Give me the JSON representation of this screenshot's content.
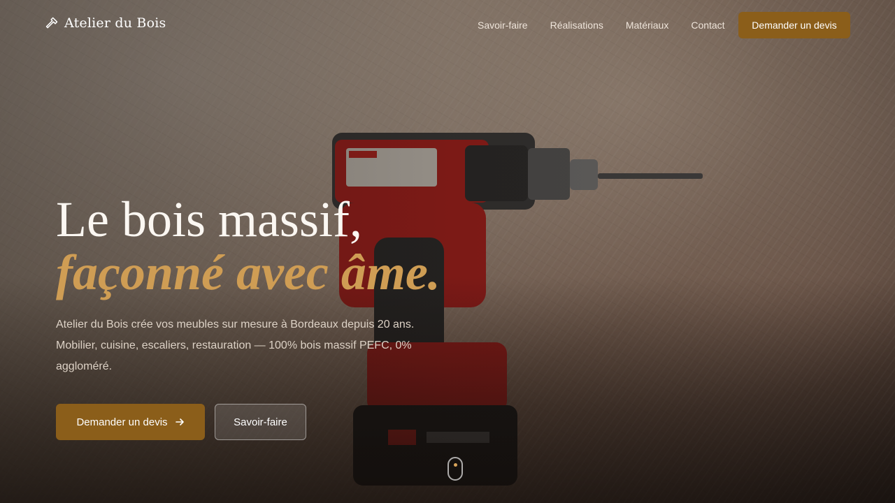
{
  "brand": {
    "name": "Atelier du Bois",
    "icon": "hammer-icon"
  },
  "nav": {
    "items": [
      "Savoir-faire",
      "Réalisations",
      "Matériaux",
      "Contact"
    ],
    "cta": "Demander un devis"
  },
  "hero": {
    "title_line1": "Le bois massif,",
    "title_line2": "façonné avec âme.",
    "description": "Atelier du Bois crée vos meubles sur mesure à Bordeaux depuis 20 ans. Mobilier, cuisine, escaliers, restauration — 100% bois massif PEFC, 0% aggloméré.",
    "primary_button": "Demander un devis",
    "secondary_button": "Savoir-faire",
    "scroll_icon": "mouse-scroll-icon"
  },
  "colors": {
    "accent": "#8b5e1a",
    "accent_text": "#cf9d54"
  }
}
